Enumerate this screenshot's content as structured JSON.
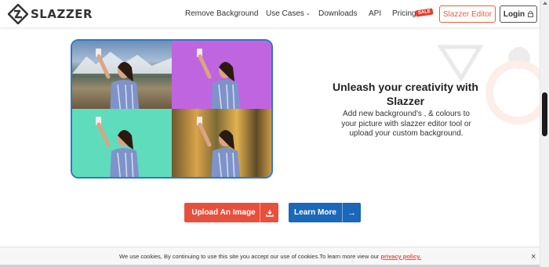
{
  "brand": {
    "name": "SLAZZER",
    "accent": "#e8503e",
    "blue": "#1b68b8",
    "grid_border": "#2d78c7"
  },
  "nav": {
    "items": [
      {
        "label": "Remove Background"
      },
      {
        "label": "Use Cases",
        "chevron": "chevron-down-icon"
      },
      {
        "label": "Downloads"
      },
      {
        "label": "API"
      },
      {
        "label": "Pricing",
        "badge": "SALE"
      }
    ],
    "editor_button": "Slazzer Editor",
    "login_button": "Login"
  },
  "hero": {
    "headline": "Unleash your creativity with Slazzer",
    "subtext": "Add new background's , & colours to your picture with slazzer editor tool or upload your custom background.",
    "tiles": [
      {
        "background": "mountain-lake-photo"
      },
      {
        "background": "#c065e0"
      },
      {
        "background": "#5fdcbc"
      },
      {
        "background": "autumn-forest-photo"
      }
    ]
  },
  "cta": {
    "upload_label": "Upload An Image",
    "upload_icon": "upload-icon",
    "learn_label": "Learn More",
    "learn_icon": "arrow-right-icon"
  },
  "cookie": {
    "text": "We use cookies, By continuing to use this site you accept our use of cookies.To learn more view our",
    "link": "privacy policy.",
    "close": "×"
  }
}
